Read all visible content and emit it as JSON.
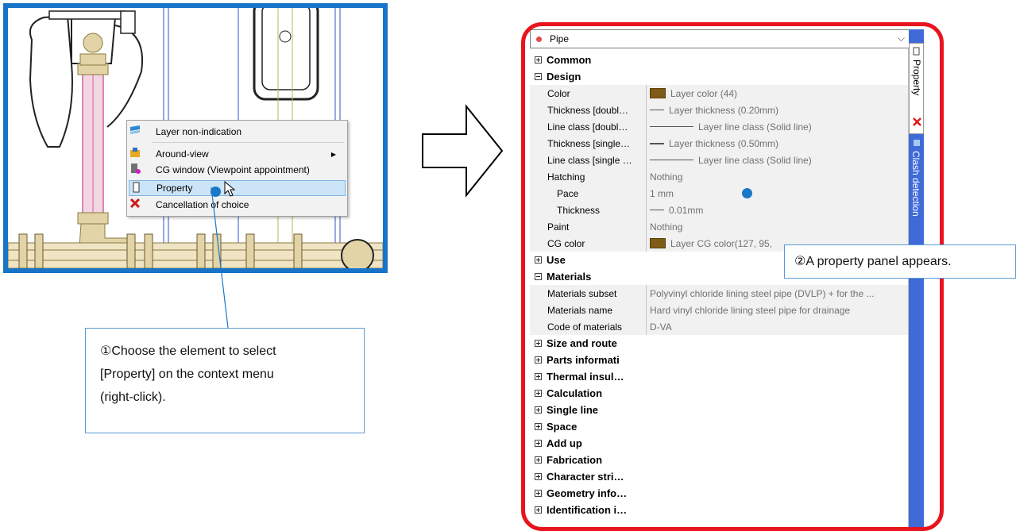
{
  "context_menu": {
    "items": [
      {
        "label": "Layer non-indication",
        "icon": "layer-icon"
      },
      {
        "label": "Around-view",
        "icon": "around-view-icon",
        "submenu": true
      },
      {
        "label": "CG window (Viewpoint appointment)",
        "icon": "cg-window-icon"
      },
      {
        "label": "Property",
        "icon": "property-icon",
        "highlighted": true
      },
      {
        "label": "Cancellation of choice",
        "icon": "cancel-x-icon"
      }
    ]
  },
  "callouts": {
    "step1_line1": "①Choose the element to select",
    "step1_line2": "[Property] on the context menu",
    "step1_line3": "(right-click).",
    "step2": "②A property panel appears."
  },
  "panel": {
    "title": "Pipe",
    "side_tabs": {
      "property": "Property",
      "clash": "Clash detection"
    },
    "categories_top": [
      {
        "label": "Common",
        "expanded": false
      },
      {
        "label": "Design",
        "expanded": true
      }
    ],
    "design_props": [
      {
        "name": "Color",
        "value": "Layer color (44)",
        "kind": "swatch"
      },
      {
        "name": "Thickness [doubl…",
        "value": "Layer thickness (0.20mm)",
        "kind": "line-short"
      },
      {
        "name": "Line class [doubl…",
        "value": "Layer line class (Solid line)",
        "kind": "line-long"
      },
      {
        "name": "Thickness [single…",
        "value": "Layer thickness (0.50mm)",
        "kind": "line-short-thick"
      },
      {
        "name": "Line class [single …",
        "value": "Layer line class (Solid line)",
        "kind": "line-long"
      },
      {
        "name": "Hatching",
        "value": "Nothing",
        "kind": "text"
      },
      {
        "name": "Pace",
        "value": "1 mm",
        "kind": "text",
        "sub": true
      },
      {
        "name": "Thickness",
        "value": "0.01mm",
        "kind": "line-short",
        "sub": true
      },
      {
        "name": "Paint",
        "value": "Nothing",
        "kind": "text"
      },
      {
        "name": "CG color",
        "value": "Layer CG color(127, 95,",
        "kind": "swatch"
      }
    ],
    "cat_use": {
      "label": "Use",
      "expanded": false
    },
    "cat_materials": {
      "label": "Materials",
      "expanded": true
    },
    "materials_props": [
      {
        "name": "Materials subset",
        "value": "Polyvinyl chloride lining steel pipe (DVLP) + for the ..."
      },
      {
        "name": "Materials name",
        "value": "Hard vinyl chloride lining steel pipe for drainage"
      },
      {
        "name": "Code of materials",
        "value": "D-VA"
      }
    ],
    "categories_bottom": [
      "Size and route",
      "Parts informati",
      "Thermal insul…",
      "Calculation",
      "Single line",
      "Space",
      "Add up",
      "Fabrication",
      "Character stri…",
      "Geometry info…",
      "Identification i…"
    ]
  },
  "colors": {
    "frame_blue": "#1874c8",
    "panel_red": "#e8141e",
    "pipe_pink": "#e8b0c8",
    "fitting_tan": "#d8c89a",
    "tab_blue": "#3f6ad8",
    "swatch_brown": "#7e5b16"
  }
}
